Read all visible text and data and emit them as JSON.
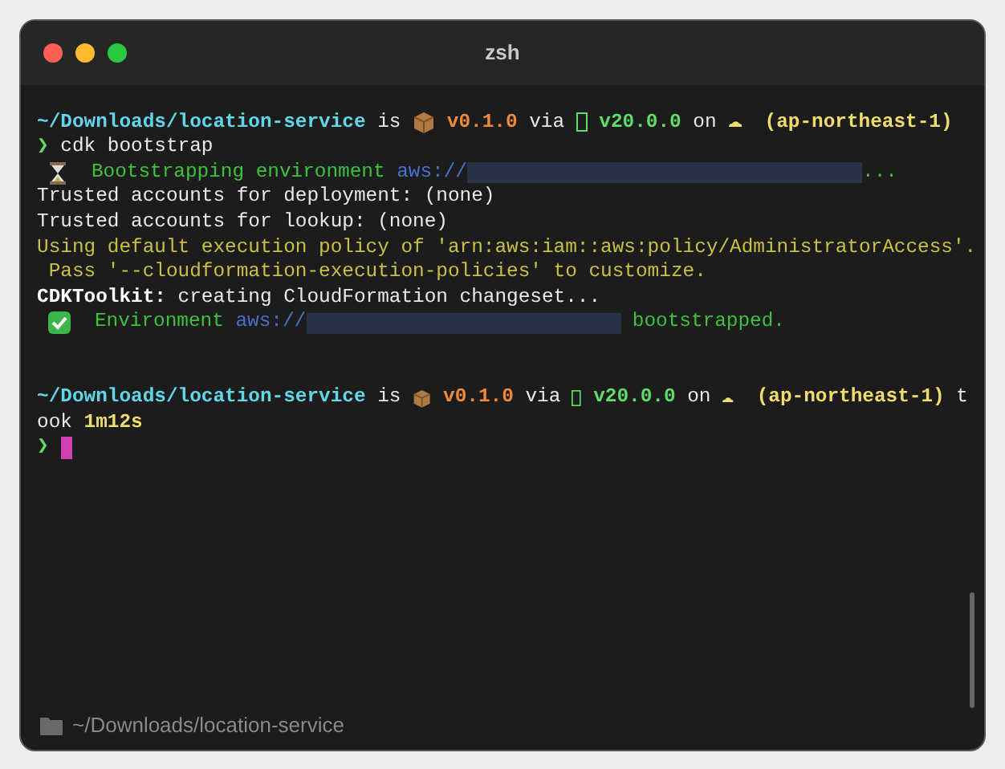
{
  "window": {
    "title": "zsh"
  },
  "lines": [
    {
      "kind": "blank"
    },
    {
      "kind": "text",
      "segments": [
        {
          "kind": "path",
          "text": "~/Downloads/location-service"
        },
        {
          "kind": "plain",
          "text": " is "
        },
        {
          "kind": "package"
        },
        {
          "kind": "version",
          "text": " v0.1.0"
        },
        {
          "kind": "plain",
          "text": " via "
        },
        {
          "kind": "nodebox"
        },
        {
          "kind": "runtime",
          "text": " v20.0.0"
        },
        {
          "kind": "plain",
          "text": " on "
        },
        {
          "kind": "cloud"
        },
        {
          "kind": "region",
          "text": "  (ap-northeast-1)"
        }
      ]
    },
    {
      "kind": "text",
      "segments": [
        {
          "kind": "prompt",
          "text": "❯"
        },
        {
          "kind": "plain",
          "text": " cdk bootstrap"
        }
      ]
    },
    {
      "kind": "text",
      "segments": [
        {
          "kind": "hourglass"
        },
        {
          "kind": "status",
          "text": "  Bootstrapping environment "
        },
        {
          "kind": "url",
          "text": "aws://"
        },
        {
          "kind": "redactedlong"
        },
        {
          "kind": "status",
          "text": "..."
        }
      ]
    },
    {
      "kind": "text",
      "segments": [
        {
          "kind": "plain",
          "text": "Trusted accounts for deployment: (none)"
        }
      ]
    },
    {
      "kind": "text",
      "segments": [
        {
          "kind": "plain",
          "text": "Trusted accounts for lookup: (none)"
        }
      ]
    },
    {
      "kind": "text",
      "segments": [
        {
          "kind": "warning",
          "text": "Using default execution policy of 'arn:aws:iam::aws:policy/AdministratorAccess'."
        }
      ]
    },
    {
      "kind": "text",
      "segments": [
        {
          "kind": "warning",
          "text": " Pass '--cloudformation-execution-policies' to customize."
        }
      ]
    },
    {
      "kind": "text",
      "segments": [
        {
          "kind": "label",
          "text": "CDKToolkit:"
        },
        {
          "kind": "plain",
          "text": " creating CloudFormation changeset..."
        }
      ]
    },
    {
      "kind": "text",
      "segments": [
        {
          "kind": "check"
        },
        {
          "kind": "status",
          "text": "  Environment "
        },
        {
          "kind": "url",
          "text": "aws://"
        },
        {
          "kind": "redactedshort"
        },
        {
          "kind": "status",
          "text": " bootstrapped."
        }
      ]
    },
    {
      "kind": "blank"
    },
    {
      "kind": "blank"
    },
    {
      "kind": "text",
      "segments": [
        {
          "kind": "path",
          "text": "~/Downloads/location-service"
        },
        {
          "kind": "plain",
          "text": " is "
        },
        {
          "kind": "package"
        },
        {
          "kind": "version",
          "text": " v0.1.0"
        },
        {
          "kind": "plain",
          "text": " via "
        },
        {
          "kind": "nodebox"
        },
        {
          "kind": "runtime",
          "text": " v20.0.0"
        },
        {
          "kind": "plain",
          "text": " on "
        },
        {
          "kind": "cloud"
        },
        {
          "kind": "region",
          "text": "  (ap-northeast-1)"
        },
        {
          "kind": "plain",
          "text": " t"
        }
      ]
    },
    {
      "kind": "text",
      "segments": [
        {
          "kind": "plain",
          "text": "ook "
        },
        {
          "kind": "region",
          "text": "1m12s"
        }
      ]
    },
    {
      "kind": "text",
      "segments": [
        {
          "kind": "prompt",
          "text": "❯"
        },
        {
          "kind": "cursor"
        }
      ]
    }
  ],
  "footer": {
    "path": "~/Downloads/location-service"
  }
}
